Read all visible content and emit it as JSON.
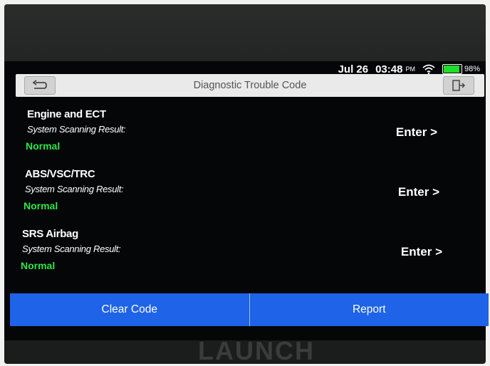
{
  "status_bar": {
    "date": "Jul 26",
    "time": "03:48",
    "ampm": "PM",
    "battery": "98%",
    "battery_level": 0.98
  },
  "header": {
    "title": "Diagnostic Trouble Code"
  },
  "systems": [
    {
      "name": "Engine and ECT",
      "scan_label": "System Scanning Result:",
      "result": "Normal",
      "enter_label": "Enter >"
    },
    {
      "name": "ABS/VSC/TRC",
      "scan_label": "System Scanning Result:",
      "result": "Normal",
      "enter_label": "Enter >"
    },
    {
      "name": "SRS Airbag",
      "scan_label": "System Scanning Result:",
      "result": "Normal",
      "enter_label": "Enter >"
    }
  ],
  "actions": {
    "clear_code": "Clear Code",
    "report": "Report"
  },
  "brand": "LAUNCH",
  "colors": {
    "accent": "#1e63e8",
    "normal_status": "#2ee44a",
    "battery": "#1ede2b"
  },
  "icons": {
    "back": "back-arrow-icon",
    "exit": "exit-icon",
    "wifi": "wifi-icon",
    "battery": "battery-icon"
  }
}
